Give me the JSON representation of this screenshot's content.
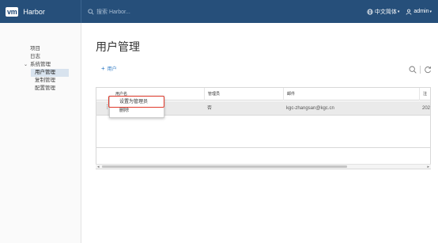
{
  "header": {
    "brand_logo": "vm",
    "brand_name": "Harbor",
    "search_placeholder": "搜索 Harbor...",
    "language": "中文简体",
    "user": "admin",
    "colors": {
      "bar": "#264f7a"
    }
  },
  "sidebar": {
    "items": [
      {
        "label": "项目"
      },
      {
        "label": "日志"
      }
    ],
    "group": {
      "label": "系统管理",
      "children": [
        {
          "label": "用户管理",
          "active": true
        },
        {
          "label": "复制管理"
        },
        {
          "label": "配置管理"
        }
      ]
    }
  },
  "main": {
    "title": "用户管理",
    "add_user_label": "用户",
    "table": {
      "columns": [
        "用户名",
        "管理员",
        "邮件",
        "注册"
      ],
      "rows": [
        {
          "username": "",
          "admin": "否",
          "email": "kgc-zhangsan@kgc.cn",
          "registered": "202"
        }
      ]
    },
    "row_menu": {
      "items": [
        "设置为管理员",
        "删除"
      ],
      "highlighted": "设置为管理员",
      "highlight_color": "#e03a2c"
    }
  }
}
